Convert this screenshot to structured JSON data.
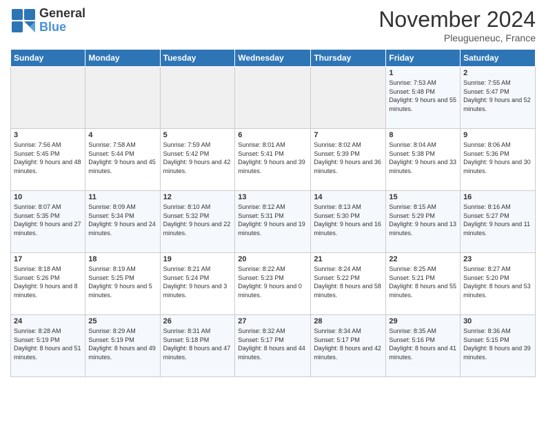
{
  "header": {
    "logo_line1": "General",
    "logo_line2": "Blue",
    "month": "November 2024",
    "location": "Pleugueneuc, France"
  },
  "weekdays": [
    "Sunday",
    "Monday",
    "Tuesday",
    "Wednesday",
    "Thursday",
    "Friday",
    "Saturday"
  ],
  "weeks": [
    [
      {
        "day": "",
        "info": ""
      },
      {
        "day": "",
        "info": ""
      },
      {
        "day": "",
        "info": ""
      },
      {
        "day": "",
        "info": ""
      },
      {
        "day": "",
        "info": ""
      },
      {
        "day": "1",
        "info": "Sunrise: 7:53 AM\nSunset: 5:48 PM\nDaylight: 9 hours and 55 minutes."
      },
      {
        "day": "2",
        "info": "Sunrise: 7:55 AM\nSunset: 5:47 PM\nDaylight: 9 hours and 52 minutes."
      }
    ],
    [
      {
        "day": "3",
        "info": "Sunrise: 7:56 AM\nSunset: 5:45 PM\nDaylight: 9 hours and 48 minutes."
      },
      {
        "day": "4",
        "info": "Sunrise: 7:58 AM\nSunset: 5:44 PM\nDaylight: 9 hours and 45 minutes."
      },
      {
        "day": "5",
        "info": "Sunrise: 7:59 AM\nSunset: 5:42 PM\nDaylight: 9 hours and 42 minutes."
      },
      {
        "day": "6",
        "info": "Sunrise: 8:01 AM\nSunset: 5:41 PM\nDaylight: 9 hours and 39 minutes."
      },
      {
        "day": "7",
        "info": "Sunrise: 8:02 AM\nSunset: 5:39 PM\nDaylight: 9 hours and 36 minutes."
      },
      {
        "day": "8",
        "info": "Sunrise: 8:04 AM\nSunset: 5:38 PM\nDaylight: 9 hours and 33 minutes."
      },
      {
        "day": "9",
        "info": "Sunrise: 8:06 AM\nSunset: 5:36 PM\nDaylight: 9 hours and 30 minutes."
      }
    ],
    [
      {
        "day": "10",
        "info": "Sunrise: 8:07 AM\nSunset: 5:35 PM\nDaylight: 9 hours and 27 minutes."
      },
      {
        "day": "11",
        "info": "Sunrise: 8:09 AM\nSunset: 5:34 PM\nDaylight: 9 hours and 24 minutes."
      },
      {
        "day": "12",
        "info": "Sunrise: 8:10 AM\nSunset: 5:32 PM\nDaylight: 9 hours and 22 minutes."
      },
      {
        "day": "13",
        "info": "Sunrise: 8:12 AM\nSunset: 5:31 PM\nDaylight: 9 hours and 19 minutes."
      },
      {
        "day": "14",
        "info": "Sunrise: 8:13 AM\nSunset: 5:30 PM\nDaylight: 9 hours and 16 minutes."
      },
      {
        "day": "15",
        "info": "Sunrise: 8:15 AM\nSunset: 5:29 PM\nDaylight: 9 hours and 13 minutes."
      },
      {
        "day": "16",
        "info": "Sunrise: 8:16 AM\nSunset: 5:27 PM\nDaylight: 9 hours and 11 minutes."
      }
    ],
    [
      {
        "day": "17",
        "info": "Sunrise: 8:18 AM\nSunset: 5:26 PM\nDaylight: 9 hours and 8 minutes."
      },
      {
        "day": "18",
        "info": "Sunrise: 8:19 AM\nSunset: 5:25 PM\nDaylight: 9 hours and 5 minutes."
      },
      {
        "day": "19",
        "info": "Sunrise: 8:21 AM\nSunset: 5:24 PM\nDaylight: 9 hours and 3 minutes."
      },
      {
        "day": "20",
        "info": "Sunrise: 8:22 AM\nSunset: 5:23 PM\nDaylight: 9 hours and 0 minutes."
      },
      {
        "day": "21",
        "info": "Sunrise: 8:24 AM\nSunset: 5:22 PM\nDaylight: 8 hours and 58 minutes."
      },
      {
        "day": "22",
        "info": "Sunrise: 8:25 AM\nSunset: 5:21 PM\nDaylight: 8 hours and 55 minutes."
      },
      {
        "day": "23",
        "info": "Sunrise: 8:27 AM\nSunset: 5:20 PM\nDaylight: 8 hours and 53 minutes."
      }
    ],
    [
      {
        "day": "24",
        "info": "Sunrise: 8:28 AM\nSunset: 5:19 PM\nDaylight: 8 hours and 51 minutes."
      },
      {
        "day": "25",
        "info": "Sunrise: 8:29 AM\nSunset: 5:19 PM\nDaylight: 8 hours and 49 minutes."
      },
      {
        "day": "26",
        "info": "Sunrise: 8:31 AM\nSunset: 5:18 PM\nDaylight: 8 hours and 47 minutes."
      },
      {
        "day": "27",
        "info": "Sunrise: 8:32 AM\nSunset: 5:17 PM\nDaylight: 8 hours and 44 minutes."
      },
      {
        "day": "28",
        "info": "Sunrise: 8:34 AM\nSunset: 5:17 PM\nDaylight: 8 hours and 42 minutes."
      },
      {
        "day": "29",
        "info": "Sunrise: 8:35 AM\nSunset: 5:16 PM\nDaylight: 8 hours and 41 minutes."
      },
      {
        "day": "30",
        "info": "Sunrise: 8:36 AM\nSunset: 5:15 PM\nDaylight: 8 hours and 39 minutes."
      }
    ]
  ]
}
